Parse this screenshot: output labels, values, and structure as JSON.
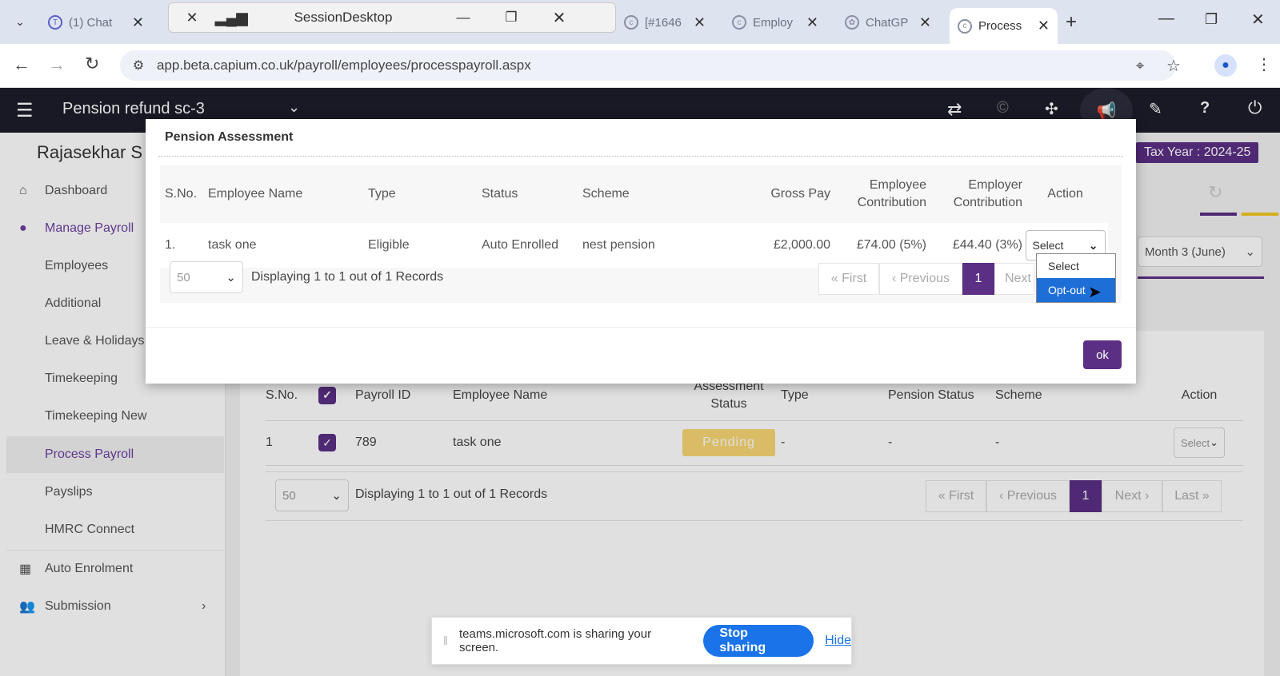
{
  "browser": {
    "tabs": [
      {
        "label": "(1) Chat"
      },
      {
        "label": "[#1646"
      },
      {
        "label": "Employ"
      },
      {
        "label": "ChatGP"
      },
      {
        "label": "Process"
      }
    ],
    "session_window_title": "SessionDesktop",
    "url": "app.beta.capium.co.uk/payroll/employees/processpayroll.aspx"
  },
  "app": {
    "client_name": "Pension refund sc-3",
    "user_name": "Rajasekhar S",
    "tax_year": "Tax Year : 2024-25",
    "period_select": "Month 3 (June)"
  },
  "sidebar": {
    "dashboard": "Dashboard",
    "manage_payroll": "Manage Payroll",
    "items": [
      "Employees",
      "Additional",
      "Leave & Holidays",
      "Timekeeping",
      "Timekeeping New",
      "Process Payroll",
      "Payslips",
      "HMRC Connect"
    ],
    "auto_enrolment": "Auto Enrolment",
    "submission": "Submission"
  },
  "main_table": {
    "headers": {
      "sno": "S.No.",
      "payroll_id": "Payroll ID",
      "employee_name": "Employee Name",
      "assessment_status": "Assessment Status",
      "type": "Type",
      "pension_status": "Pension Status",
      "scheme": "Scheme",
      "action": "Action"
    },
    "row": {
      "sno": "1",
      "payroll_id": "789",
      "employee_name": "task one",
      "assessment_status": "Pending",
      "type": "-",
      "pension_status": "-",
      "scheme": "-",
      "action": "Select"
    },
    "page_size": "50",
    "records_text": "Displaying 1 to 1 out of 1 Records",
    "pager": {
      "first": "« First",
      "previous": "‹ Previous",
      "current": "1",
      "next": "Next ›",
      "last": "Last »"
    }
  },
  "modal": {
    "title": "Pension Assessment",
    "headers": {
      "sno": "S.No.",
      "employee_name": "Employee Name",
      "type": "Type",
      "status": "Status",
      "scheme": "Scheme",
      "gross_pay": "Gross Pay",
      "employee_contribution": "Employee Contribution",
      "employer_contribution": "Employer Contribution",
      "action": "Action"
    },
    "row": {
      "sno": "1.",
      "employee_name": "task one",
      "type": "Eligible",
      "status": "Auto Enrolled",
      "scheme": "nest pension",
      "gross_pay": "£2,000.00",
      "employee_contribution": "£74.00 (5%)",
      "employer_contribution": "£44.40 (3%)",
      "action_selected": "Select"
    },
    "action_options": [
      "Select",
      "Opt-out"
    ],
    "page_size": "50",
    "records_text": "Displaying 1 to 1 out of 1 Records",
    "pager": {
      "first": "« First",
      "previous": "‹ Previous",
      "current": "1",
      "next": "Next"
    },
    "ok_label": "ok"
  },
  "sharebar": {
    "message": "teams.microsoft.com is sharing your screen.",
    "stop_label": "Stop sharing",
    "hide_label": "Hide"
  },
  "colors": {
    "brand": "#5b2f84",
    "pending": "#f7d774",
    "header": "#1d1d2b",
    "link": "#1a73e8"
  }
}
